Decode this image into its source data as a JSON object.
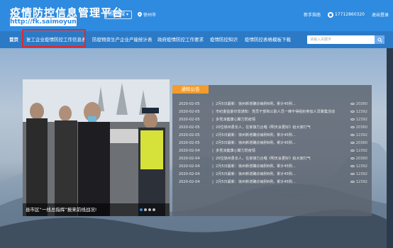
{
  "header": {
    "logo_title": "疫情防控信息管理平台",
    "logo_url": "http://fk.saimoyun.com",
    "region_button": "切换区域",
    "location": "徐州市",
    "guide": "新手指南",
    "phone": "17712860320",
    "logout": "退出登录"
  },
  "nav": {
    "items": [
      {
        "label": "首页"
      },
      {
        "label": "复工企业疫情防控工作信息表"
      },
      {
        "label": "防疫物资生产企业产能统计表"
      },
      {
        "label": "政府疫情防控工作要求"
      },
      {
        "label": "疫情防控知识"
      },
      {
        "label": "疫情防控表格模板下载"
      }
    ],
    "search_placeholder": "请输入关键字"
  },
  "carousel": {
    "caption": "县市区“一线总指挥”报来前线战况!"
  },
  "notice": {
    "tab": "通知公告",
    "rows": [
      {
        "date": "2020-02-05",
        "title": "2月5日最新：徐州新增确诊病例6例，累计45例...",
        "views": "20360"
      },
      {
        "date": "2020-02-05",
        "title": "市纪委监委印发通知：党员干部和公职人员一律不得组织参加人员聚集活动",
        "views": "12392"
      },
      {
        "date": "2020-02-05",
        "title": "多党派健康心聚力防疫情",
        "views": "12392"
      },
      {
        "date": "2020-02-05",
        "title": "20位徐州县长人，在家接力合唱《明天会更好》给大家打气",
        "views": "20360"
      },
      {
        "date": "2020-02-05",
        "title": "2月5日最新：徐州新增确诊病例6例，累计45例...",
        "views": "12392"
      },
      {
        "date": "2020-02-05",
        "title": "2月5日最新：徐州新增确诊病例6例，累计45例...",
        "views": "20360"
      },
      {
        "date": "2020-02-04",
        "title": "多党派健康心聚力防疫情",
        "views": "12392"
      },
      {
        "date": "2020-02-04",
        "title": "20位徐州县长人，在家接力合唱《明天会更好》给大家打气",
        "views": "20360"
      },
      {
        "date": "2020-02-04",
        "title": "2月5日最新：徐州新增确诊病例6例，累计45例...",
        "views": "12392"
      },
      {
        "date": "2020-02-04",
        "title": "2月5日最新：徐州新增确诊病例6例，累计45例...",
        "views": "12392"
      },
      {
        "date": "2020-02-04",
        "title": "2月5日最新：徐州新增确诊病例6例，累计45例...",
        "views": "12392"
      }
    ]
  }
}
